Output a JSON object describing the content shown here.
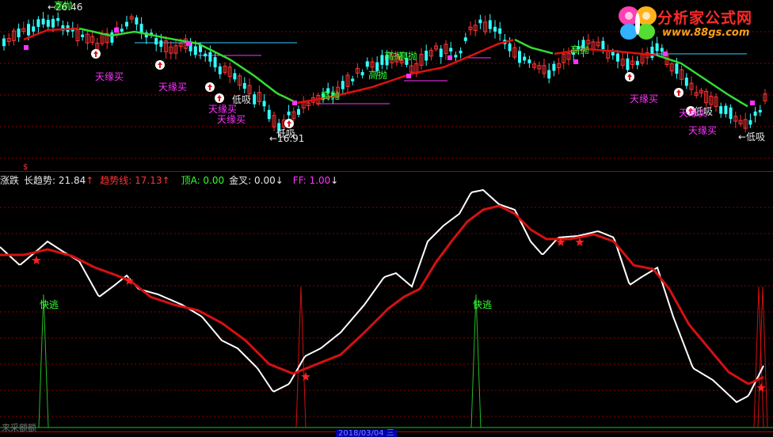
{
  "labels": {
    "top_high_value": "←26.46",
    "low_value": "←16.91",
    "high_throw": "高抛",
    "low_absorb": "低吸",
    "low_absorb_arrow": "←低吸",
    "tianyuan_buy": "天缘买",
    "fast_escape": "快逃",
    "dollar_mark": "$"
  },
  "legend": {
    "prefix": "涨跌",
    "long_trend": "长趋势: 21.84",
    "trend_line": "趋势线: 17.13",
    "top_a": "顶A: 0.00",
    "golden_cross": "金叉: 0.00",
    "ff": "FF: 1.00"
  },
  "logo": {
    "title": "分析家公式网",
    "url": "www.88gs.com"
  },
  "footer": {
    "bottom_text": "来采额额",
    "date_label": "2018/03/04 三"
  },
  "colors": {
    "up_candle": "#ff3333",
    "down_candle": "#33ffff",
    "red_line": "#e01010",
    "green_line": "#33dd33",
    "white_line": "#ffffff",
    "magenta": "#ff33ff",
    "grid": "#8b0000"
  },
  "icons": [
    "white-circle-up-arrow-icon",
    "magenta-square-marker-icon",
    "red-star-icon",
    "butterfly-logo-icon"
  ]
}
